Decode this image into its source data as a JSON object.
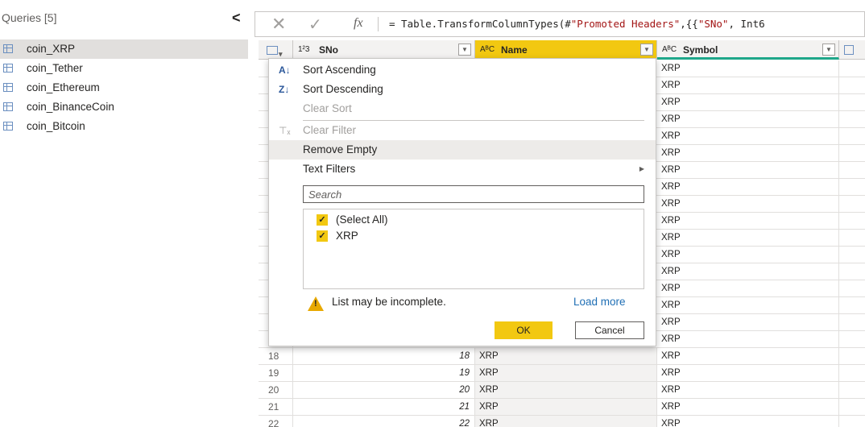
{
  "queries": {
    "title": "Queries [5]",
    "collapse_icon": "chevron-left-icon",
    "items": [
      {
        "label": "coin_XRP",
        "selected": true
      },
      {
        "label": "coin_Tether"
      },
      {
        "label": "coin_Ethereum"
      },
      {
        "label": "coin_BinanceCoin"
      },
      {
        "label": "coin_Bitcoin"
      }
    ]
  },
  "formula_bar": {
    "cancel_glyph": "✕",
    "commit_glyph": "✓",
    "fx_label": "fx",
    "formula_prefix": "= Table.TransformColumnTypes(#",
    "formula_str1": "\"Promoted Headers\"",
    "formula_mid": ",{{",
    "formula_str2": "\"SNo\"",
    "formula_tail": ", Int6"
  },
  "grid": {
    "columns": [
      {
        "type_icon": "1²3",
        "label": "SNo"
      },
      {
        "type_icon": "AᴮC",
        "label": "Name"
      },
      {
        "type_icon": "AᴮC",
        "label": "Symbol"
      }
    ],
    "symbol_column_values": [
      "XRP",
      "XRP",
      "XRP",
      "XRP",
      "XRP",
      "XRP",
      "XRP",
      "XRP",
      "XRP",
      "XRP",
      "XRP",
      "XRP",
      "XRP",
      "XRP",
      "XRP",
      "XRP",
      "XRP"
    ],
    "rows": [
      {
        "idx": "18",
        "sno": "18",
        "name": "XRP",
        "symbol": "XRP"
      },
      {
        "idx": "19",
        "sno": "19",
        "name": "XRP",
        "symbol": "XRP"
      },
      {
        "idx": "20",
        "sno": "20",
        "name": "XRP",
        "symbol": "XRP"
      },
      {
        "idx": "21",
        "sno": "21",
        "name": "XRP",
        "symbol": "XRP"
      },
      {
        "idx": "22",
        "sno": "22",
        "name": "XRP",
        "symbol": "XRP"
      }
    ]
  },
  "filter_menu": {
    "sort_ascending": "Sort Ascending",
    "sort_descending": "Sort Descending",
    "clear_sort": "Clear Sort",
    "clear_filter": "Clear Filter",
    "remove_empty": "Remove Empty",
    "text_filters": "Text Filters",
    "search_placeholder": "Search",
    "values": [
      "(Select All)",
      "XRP"
    ],
    "warning": "List may be incomplete.",
    "load_more": "Load more",
    "ok": "OK",
    "cancel": "Cancel"
  },
  "colors": {
    "accent": "#f2c811",
    "selected_query_bg": "#e1dfdd",
    "symbol_header_underline": "#1fa78a",
    "link": "#1f6fb5"
  }
}
